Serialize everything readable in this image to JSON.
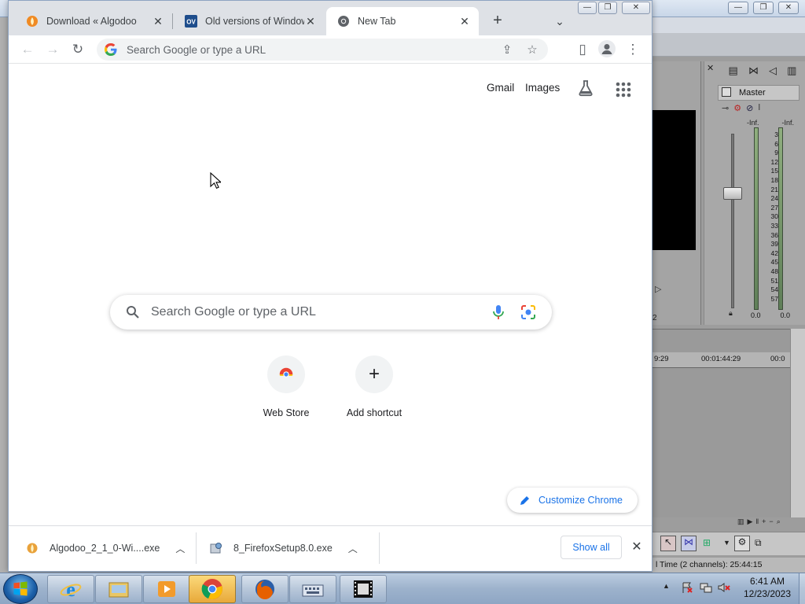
{
  "chrome": {
    "tabs": [
      {
        "title": "Download « Algodoo",
        "active": false
      },
      {
        "title": "Old versions of Windows",
        "active": false
      },
      {
        "title": "New Tab",
        "active": true
      }
    ],
    "omnibox_placeholder": "Search Google or type a URL"
  },
  "ntp": {
    "links": {
      "gmail": "Gmail",
      "images": "Images"
    },
    "search_placeholder": "Search Google or type a URL",
    "shortcuts": [
      {
        "label": "Web Store",
        "icon": "chrome-webstore-icon"
      },
      {
        "label": "Add shortcut",
        "icon": "plus-icon"
      }
    ],
    "customize_label": "Customize Chrome"
  },
  "downloads": {
    "items": [
      {
        "name": "Algodoo_2_1_0-Wi....exe",
        "icon": "algodoo-icon"
      },
      {
        "name": "8_FirefoxSetup8.0.exe",
        "icon": "installer-icon"
      }
    ],
    "show_all": "Show all"
  },
  "background_app": {
    "master_label": "Master",
    "meter_top": [
      "-Inf.",
      "-Inf."
    ],
    "meter_scale": [
      "3",
      "6",
      "9",
      "12",
      "15",
      "18",
      "21",
      "24",
      "27",
      "30",
      "33",
      "36",
      "39",
      "42",
      "45",
      "48",
      "51",
      "54",
      "57"
    ],
    "meter_values": [
      "0.0",
      "0.0"
    ],
    "timeline_marks": [
      "9:29",
      "00:01:44:29",
      "00:0"
    ],
    "preview_label": "2",
    "status_text": "l Time (2 channels): 25:44:15"
  },
  "taskbar": {
    "apps": [
      "Internet Explorer",
      "Windows Explorer",
      "Windows Media Player",
      "Google Chrome",
      "Firefox",
      "On-Screen Keyboard",
      "Video Editor"
    ],
    "clock": {
      "time": "6:41 AM",
      "date": "12/23/2023"
    }
  },
  "colors": {
    "accent_blue": "#1a73e8",
    "tab_strip": "#dee1e6",
    "taskbar": "#9db2cc"
  }
}
